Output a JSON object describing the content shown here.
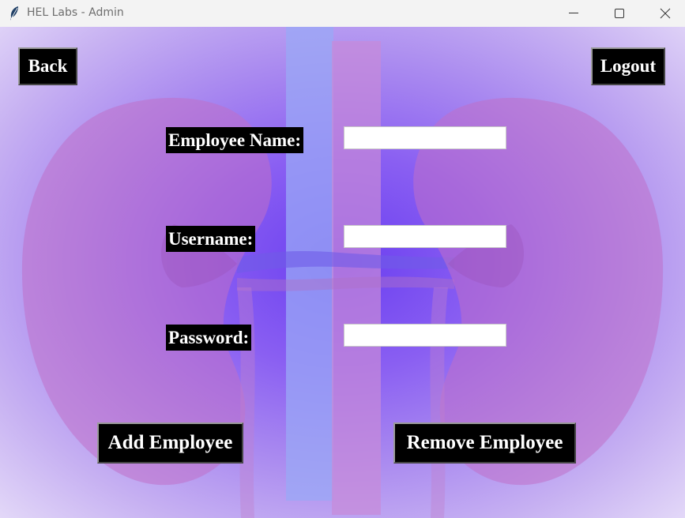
{
  "window": {
    "title": "HEL Labs - Admin",
    "icon": "feather-icon",
    "controls": [
      "minimize-icon",
      "maximize-icon",
      "close-icon"
    ]
  },
  "nav": {
    "back_label": "Back",
    "logout_label": "Logout"
  },
  "form": {
    "name_label": "Employee Name:",
    "username_label": "Username:",
    "password_label": "Password:",
    "name_value": "",
    "username_value": "",
    "password_value": ""
  },
  "actions": {
    "add_label": "Add Employee",
    "remove_label": "Remove Employee"
  },
  "colors": {
    "button_bg": "#000000",
    "button_text": "#ffffff",
    "background_center": "#6a3ef0",
    "background_edge": "#e3d8f8",
    "kidney": "#c070c8",
    "vein": "#9aa8f5"
  }
}
